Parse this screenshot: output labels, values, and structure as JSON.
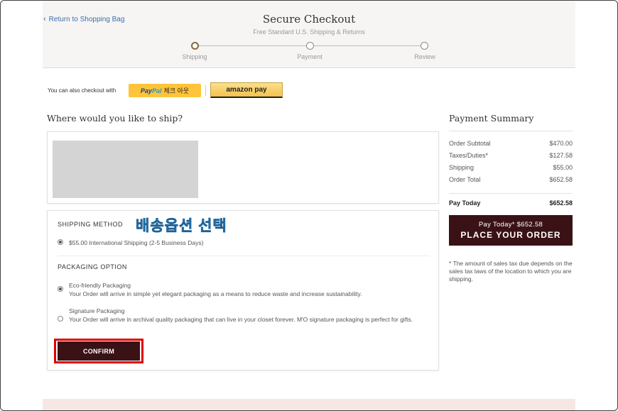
{
  "header": {
    "back_link": "Return to Shopping Bag",
    "title": "Secure Checkout",
    "subtitle": "Free Standard U.S. Shipping & Returns",
    "steps": [
      {
        "label": "Shipping",
        "active": true
      },
      {
        "label": "Payment",
        "active": false
      },
      {
        "label": "Review",
        "active": false
      }
    ]
  },
  "alt_checkout": {
    "label": "You can also checkout with",
    "paypal_brand_a": "Pay",
    "paypal_brand_b": "Pal",
    "paypal_text": "체크 아웃",
    "amazon_text": "amazon pay"
  },
  "shipping": {
    "question": "Where would you like to ship?",
    "method_heading": "SHIPPING METHOD",
    "annotation": "배송옵션 선택",
    "method_option": "$55.00 International Shipping (2-5 Business Days)",
    "packaging_heading": "PACKAGING OPTION",
    "packaging_options": [
      {
        "title": "Eco-friendly Packaging",
        "desc": "Your Order will arrive in simple yet elegant packaging as a means to reduce waste and increase sustainability.",
        "checked": true
      },
      {
        "title": "Signature Packaging",
        "desc": "Your Order will arrive in archival quality packaging that can live in your closet forever. M'O signature packaging is perfect for gifts.",
        "checked": false
      }
    ],
    "confirm_label": "CONFIRM"
  },
  "summary": {
    "title": "Payment Summary",
    "rows": [
      {
        "label": "Order Subtotal",
        "value": "$470.00"
      },
      {
        "label": "Taxes/Duties*",
        "value": "$127.58"
      },
      {
        "label": "Shipping",
        "value": "$55.00"
      },
      {
        "label": "Order Total",
        "value": "$652.58"
      }
    ],
    "pay_today_label": "Pay Today",
    "pay_today_value": "$652.58",
    "place_order_top": "Pay Today* $652.58",
    "place_order_label": "PLACE YOUR ORDER",
    "tax_note": "* The amount of sales tax due depends on the sales tax laws of the location to which you are shipping."
  },
  "colors": {
    "accent_dark": "#3a1215",
    "annotation": "#3aa8e8",
    "highlight_outline": "#e00000",
    "active_step": "#8a6a3c"
  }
}
